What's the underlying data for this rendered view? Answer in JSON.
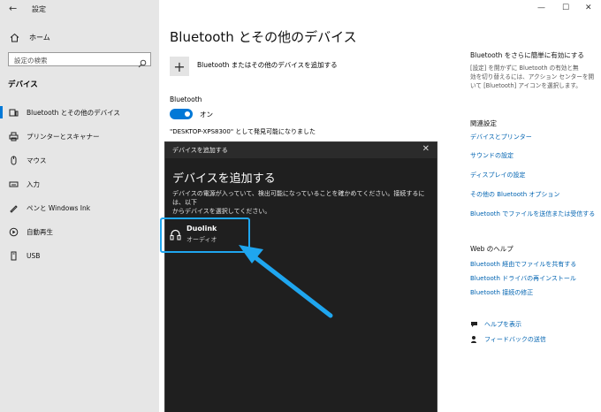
{
  "app": {
    "title": "設定",
    "back_glyph": "←"
  },
  "window_controls": {
    "minimize": "—",
    "maximize": "☐",
    "close": "✕"
  },
  "sidebar": {
    "home_label": "ホーム",
    "search_placeholder": "設定の検索",
    "section_title": "デバイス",
    "items": [
      {
        "label": "Bluetooth とその他のデバイス",
        "icon": "bluetooth-devices-icon",
        "active": true
      },
      {
        "label": "プリンターとスキャナー",
        "icon": "printer-icon",
        "active": false
      },
      {
        "label": "マウス",
        "icon": "mouse-icon",
        "active": false
      },
      {
        "label": "入力",
        "icon": "keyboard-icon",
        "active": false
      },
      {
        "label": "ペンと Windows Ink",
        "icon": "pen-icon",
        "active": false
      },
      {
        "label": "自動再生",
        "icon": "autoplay-icon",
        "active": false
      },
      {
        "label": "USB",
        "icon": "usb-icon",
        "active": false
      }
    ]
  },
  "main": {
    "title": "Bluetooth とその他のデバイス",
    "add_device_label": "Bluetooth またはその他のデバイスを追加する",
    "bluetooth_label": "Bluetooth",
    "toggle_state": "オン",
    "discoverable_text": "\"DESKTOP-XPS8300\" として発見可能になりました"
  },
  "right_panel": {
    "heading1": "Bluetooth をさらに簡単に有効にする",
    "desc_lines": [
      "[設定] を開かずに Bluetooth の有効と無",
      "効を切り替えるには、アクション センターを開",
      "いて [Bluetooth] アイコンを選択します。"
    ],
    "related_heading": "関連設定",
    "related_links": [
      "デバイスとプリンター",
      "サウンドの設定",
      "ディスプレイの設定",
      "その他の Bluetooth オプション",
      "Bluetooth でファイルを送信または受信する"
    ],
    "web_help_heading": "Web のヘルプ",
    "web_links": [
      "Bluetooth 経由でファイルを共有する",
      "Bluetooth ドライバの再インストール",
      "Bluetooth 接続の修正"
    ],
    "help_link": "ヘルプを表示",
    "feedback_link": "フィードバックの送信"
  },
  "dialog": {
    "title": "デバイスを追加する",
    "close_glyph": "✕",
    "heading": "デバイスを追加する",
    "desc_lines": [
      "デバイスの電源が入っていて、検出可能になっていることを確かめてください。接続するには、以下",
      "からデバイスを選択してください。"
    ],
    "device_name": "Duolink",
    "device_type": "オーディオ"
  },
  "colors": {
    "accent": "#0078d7",
    "link": "#0063b1",
    "highlight": "#1fa6ef",
    "dialog_bg": "#1f1f1f"
  }
}
